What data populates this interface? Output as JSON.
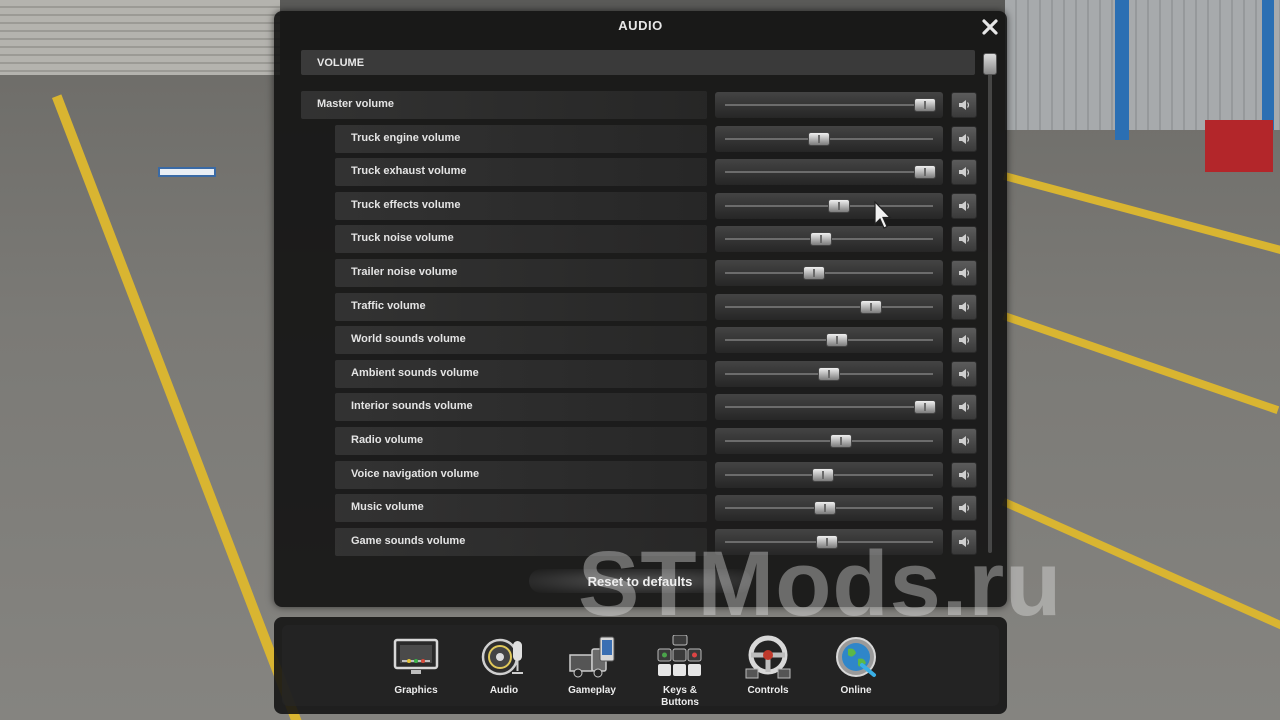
{
  "dialog": {
    "title": "AUDIO",
    "close_icon": "close-icon",
    "section_title": "VOLUME",
    "reset_label": "Reset to defaults"
  },
  "volumes": [
    {
      "label": "Master volume",
      "value": 0.96,
      "indent": 0
    },
    {
      "label": "Truck engine volume",
      "value": 0.45,
      "indent": 1
    },
    {
      "label": "Truck exhaust volume",
      "value": 0.96,
      "indent": 1
    },
    {
      "label": "Truck effects volume",
      "value": 0.55,
      "indent": 1
    },
    {
      "label": "Truck noise volume",
      "value": 0.46,
      "indent": 1
    },
    {
      "label": "Trailer noise volume",
      "value": 0.43,
      "indent": 1
    },
    {
      "label": "Traffic volume",
      "value": 0.7,
      "indent": 1
    },
    {
      "label": "World sounds volume",
      "value": 0.54,
      "indent": 1
    },
    {
      "label": "Ambient sounds volume",
      "value": 0.5,
      "indent": 1
    },
    {
      "label": "Interior sounds volume",
      "value": 0.96,
      "indent": 1
    },
    {
      "label": "Radio volume",
      "value": 0.56,
      "indent": 1
    },
    {
      "label": "Voice navigation volume",
      "value": 0.47,
      "indent": 1
    },
    {
      "label": "Music volume",
      "value": 0.48,
      "indent": 1
    },
    {
      "label": "Game sounds volume",
      "value": 0.49,
      "indent": 1
    }
  ],
  "nav": [
    {
      "label": "Graphics",
      "icon": "monitor-icon"
    },
    {
      "label": "Audio",
      "icon": "speaker-icon"
    },
    {
      "label": "Gameplay",
      "icon": "truck-icon"
    },
    {
      "label": "Keys &\nButtons",
      "icon": "keyboard-icon"
    },
    {
      "label": "Controls",
      "icon": "steering-wheel-icon"
    },
    {
      "label": "Online",
      "icon": "globe-icon"
    }
  ],
  "watermark": "STMods.ru",
  "colors": {
    "accent_yellow": "#d9b531",
    "panel": "#121212",
    "text": "#e8e8e8"
  }
}
